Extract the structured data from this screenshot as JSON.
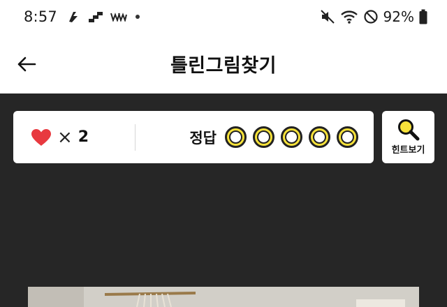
{
  "status_bar": {
    "time": "8:57",
    "battery": "92%",
    "icons": [
      "run-icon",
      "stairs-icon",
      "ww-icon",
      "dot-icon",
      "mute-icon",
      "wifi-icon",
      "do-not-disturb-icon",
      "battery-icon"
    ]
  },
  "header": {
    "title": "틀린그림찾기",
    "back_icon": "arrow-left-icon"
  },
  "score_panel": {
    "lives_icon": "heart-icon",
    "lives_times": "×",
    "lives_count": "2",
    "answer_label": "정답",
    "answer_total": 5,
    "answers_found": 0
  },
  "hint": {
    "label": "힌트보기",
    "icon": "magnifier-icon"
  },
  "colors": {
    "background": "#262626",
    "heart": "#e8393f",
    "answer_slot": "#f7e23a"
  }
}
